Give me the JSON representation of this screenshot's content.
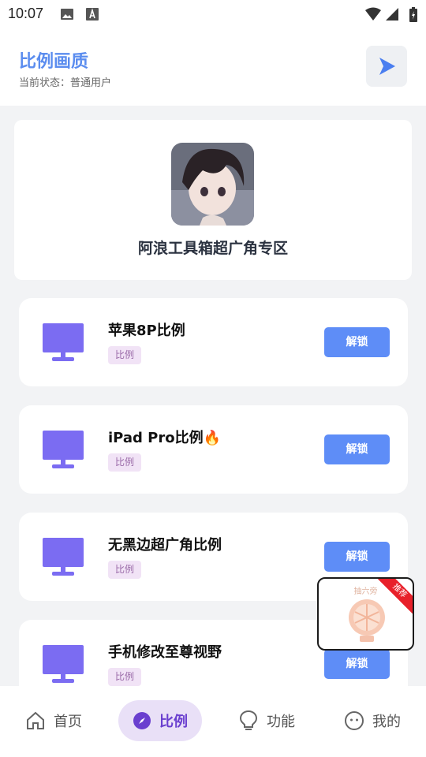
{
  "status_bar": {
    "time": "10:07"
  },
  "header": {
    "title": "比例画质",
    "subtitle": "当前状态：普通用户"
  },
  "hero": {
    "title": "阿浪工具箱超广角专区"
  },
  "cards": [
    {
      "title": "苹果8P比例",
      "tag": "比例",
      "button": "解锁"
    },
    {
      "title": "iPad Pro比例🔥",
      "tag": "比例",
      "button": "解锁"
    },
    {
      "title": "无黑边超广角比例",
      "tag": "比例",
      "button": "解锁"
    },
    {
      "title": "手机修改至尊视野",
      "tag": "比例",
      "button": "解锁"
    }
  ],
  "float_ad": {
    "label": "抽六旁",
    "badge": "推荐"
  },
  "tabs": [
    {
      "label": "首页",
      "icon": "home-icon",
      "active": false
    },
    {
      "label": "比例",
      "icon": "compass-icon",
      "active": true
    },
    {
      "label": "功能",
      "icon": "lightbulb-icon",
      "active": false
    },
    {
      "label": "我的",
      "icon": "face-icon",
      "active": false
    }
  ],
  "colors": {
    "accent": "#5e8df7",
    "title_blue": "#5b8def",
    "icon_purple": "#7b6cf2",
    "active_tab": "#6a3fcf",
    "tag_bg": "#f1e3f6"
  }
}
